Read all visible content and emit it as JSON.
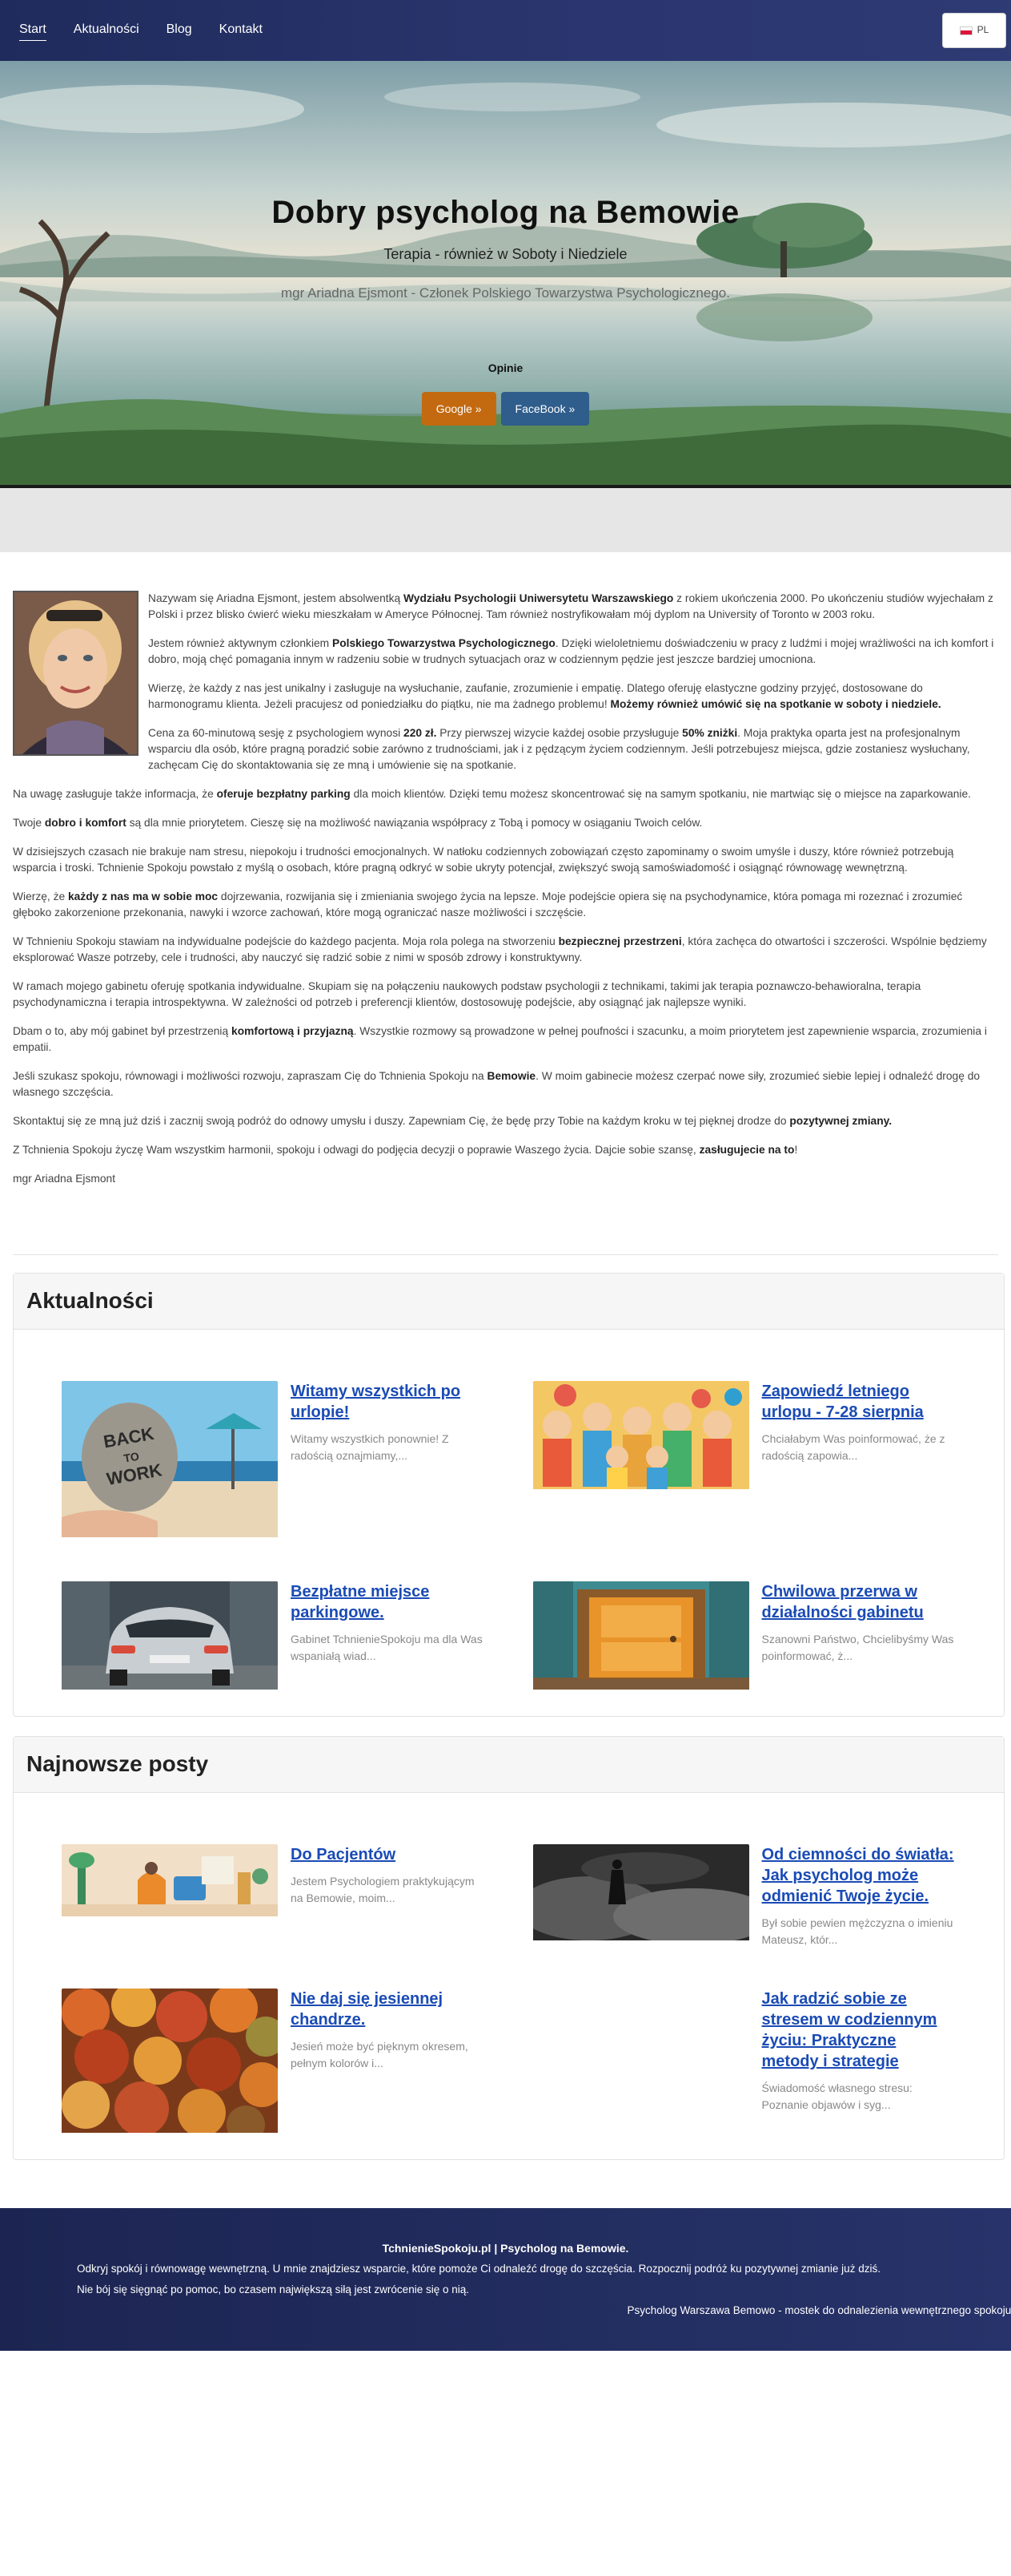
{
  "nav": {
    "items": [
      "Start",
      "Aktualności",
      "Blog",
      "Kontakt"
    ],
    "language": "PL"
  },
  "hero": {
    "title": "Dobry psycholog na Bemowie",
    "subtitle": "Terapia - również w Soboty i Niedziele",
    "credentials": "mgr Ariadna Ejsmont - Członek Polskiego Towarzystwa Psychologicznego.",
    "opinions_label": "Opinie",
    "google_button": "Google »",
    "facebook_button": "FaceBook »"
  },
  "about": {
    "p1": [
      {
        "t": "Nazywam się Ariadna Ejsmont, jestem absolwentką "
      },
      {
        "t": "Wydziału Psychologii Uniwersytetu Warszawskiego",
        "b": true
      },
      {
        "t": " z rokiem ukończenia 2000. Po ukończeniu studiów wyjechałam z Polski i przez blisko ćwierć wieku mieszkałam w Ameryce Północnej. Tam również nostryfikowałam mój dyplom na University of Toronto w 2003 roku."
      }
    ],
    "p2": [
      {
        "t": "Jestem również aktywnym członkiem "
      },
      {
        "t": "Polskiego Towarzystwa Psychologicznego",
        "b": true
      },
      {
        "t": ". Dzięki wieloletniemu doświadczeniu w pracy z ludźmi i mojej wrażliwości na ich komfort i dobro, moją chęć pomagania innym w radzeniu sobie w trudnych sytuacjach oraz w codziennym pędzie jest jeszcze bardziej umocniona."
      }
    ],
    "p3": [
      {
        "t": "Wierzę, że każdy z nas jest unikalny i zasługuje na wysłuchanie, zaufanie, zrozumienie i empatię. Dlatego oferuję elastyczne godziny przyjęć, dostosowane do harmonogramu klienta. Jeżeli pracujesz od poniedziałku do piątku, nie ma żadnego problemu! "
      },
      {
        "t": "Możemy również umówić się na spotkanie w soboty i niedziele.",
        "b": true
      }
    ],
    "p4": [
      {
        "t": "Cena za 60-minutową sesję z psychologiem wynosi "
      },
      {
        "t": "220 zł.",
        "b": true
      },
      {
        "t": " Przy pierwszej wizycie każdej osobie przysługuje "
      },
      {
        "t": "50% zniżki",
        "b": true
      },
      {
        "t": ". Moja praktyka oparta jest na profesjonalnym wsparciu dla osób, które pragną poradzić sobie zarówno z trudnościami, jak i z pędzącym życiem codziennym. Jeśli potrzebujesz miejsca, gdzie zostaniesz wysłuchany, zachęcam Cię do skontaktowania się ze mną i umówienie się na spotkanie."
      }
    ],
    "p5": [
      {
        "t": " Na uwagę zasługuje także informacja, że "
      },
      {
        "t": "oferuje bezpłatny parking",
        "b": true
      },
      {
        "t": " dla moich klientów. Dzięki temu możesz skoncentrować się na samym spotkaniu, nie martwiąc się o miejsce na zaparkowanie."
      }
    ],
    "p6": [
      {
        "t": "Twoje "
      },
      {
        "t": "dobro i komfort",
        "b": true
      },
      {
        "t": " są dla mnie priorytetem. Cieszę się na możliwość nawiązania współpracy z Tobą i pomocy w osiąganiu Twoich celów."
      }
    ],
    "p7": [
      {
        "t": "W dzisiejszych czasach nie brakuje nam stresu, niepokoju i trudności emocjonalnych. W natłoku codziennych zobowiązań często zapominamy o swoim umyśle i duszy, które również potrzebują wsparcia i troski. Tchnienie Spokoju powstało z myślą o osobach, które pragną odkryć w sobie ukryty potencjał, zwiększyć swoją samoświadomość i osiągnąć równowagę wewnętrzną."
      }
    ],
    "p8": [
      {
        "t": "Wierzę, że "
      },
      {
        "t": "każdy z nas ma w sobie moc",
        "b": true
      },
      {
        "t": " dojrzewania, rozwijania się i zmieniania swojego życia na lepsze. Moje podejście opiera się na psychodynamice, która pomaga mi rozeznać i zrozumieć głęboko zakorzenione przekonania, nawyki i wzorce zachowań, które mogą ograniczać nasze możliwości i szczęście."
      }
    ],
    "p9": [
      {
        "t": "W Tchnieniu Spokoju stawiam na indywidualne podejście do każdego pacjenta. Moja rola polega na stworzeniu "
      },
      {
        "t": "bezpiecznej przestrzeni",
        "b": true
      },
      {
        "t": ", która zachęca do otwartości i szczerości. Wspólnie będziemy eksplorować Wasze potrzeby, cele i trudności, aby nauczyć się radzić sobie z nimi w sposób zdrowy i konstruktywny."
      }
    ],
    "p10": [
      {
        "t": "W ramach mojego gabinetu oferuję spotkania indywidualne. Skupiam się na połączeniu naukowych podstaw psychologii z technikami, takimi jak terapia poznawczo-behawioralna, terapia psychodynamiczna i terapia introspektywna. W zależności od potrzeb i preferencji klientów, dostosowuję podejście, aby osiągnąć jak najlepsze wyniki."
      }
    ],
    "p11": [
      {
        "t": "Dbam o to, aby mój gabinet był przestrzenią "
      },
      {
        "t": "komfortową i przyjazną",
        "b": true
      },
      {
        "t": ". Wszystkie rozmowy są prowadzone w pełnej poufności i szacunku, a moim priorytetem jest zapewnienie wsparcia, zrozumienia i empatii."
      }
    ],
    "p12": [
      {
        "t": "Jeśli szukasz spokoju, równowagi i możliwości rozwoju, zapraszam Cię do Tchnienia Spokoju na "
      },
      {
        "t": "Bemowie",
        "b": true
      },
      {
        "t": ". W moim gabinecie możesz czerpać nowe siły, zrozumieć siebie lepiej i odnaleźć drogę do własnego szczęścia."
      }
    ],
    "p13": [
      {
        "t": "Skontaktuj się ze mną już dziś i zacznij swoją podróż do odnowy umysłu i duszy. Zapewniam Cię, że będę przy Tobie na każdym kroku w tej pięknej drodze do "
      },
      {
        "t": "pozytywnej zmiany.",
        "b": true
      }
    ],
    "p14": [
      {
        "t": "Z Tchnienia Spokoju życzę Wam wszystkim harmonii, spokoju i odwagi do podjęcia decyzji o poprawie Waszego życia. Dajcie sobie szansę, "
      },
      {
        "t": "zasługujecie na to",
        "b": true
      },
      {
        "t": "!"
      }
    ],
    "signature": "mgr Ariadna Ejsmont"
  },
  "news": {
    "heading": "Aktualności",
    "items": [
      {
        "title": "Witamy wszystkich po urlopie!",
        "excerpt": "Witamy wszystkich ponownie! Z radością oznajmiamy,...",
        "image": "back-to-work-stone-beach-image"
      },
      {
        "title": "Zapowiedź letniego urlopu - 7-28 sierpnia",
        "excerpt": "Chciałabym Was poinformować, że z radością zapowia...",
        "image": "cartoon-family-group-image"
      },
      {
        "title": "Bezpłatne miejsce parkingowe.",
        "excerpt": "Gabinet TchnienieSpokoju ma dla Was wspaniałą wiad...",
        "image": "parked-car-garage-image"
      },
      {
        "title": "Chwilowa przerwa w działalności gabinetu",
        "excerpt": "Szanowni Państwo, Chcielibyśmy Was poinformować, ż...",
        "image": "closed-door-image"
      }
    ]
  },
  "posts": {
    "heading": "Najnowsze posty",
    "items": [
      {
        "title": "Do Pacjentów",
        "excerpt": "Jestem Psychologiem praktykującym na Bemowie, moim...",
        "image": "therapy-session-illustration-image"
      },
      {
        "title": "Od ciemności do światła: Jak psycholog może odmienić Twoje życie.",
        "excerpt": "Był sobie pewien mężczyzna o imieniu Mateusz, któr...",
        "image": "dark-figure-clouds-image"
      },
      {
        "title": "Nie daj się jesiennej chandrze.",
        "excerpt": "Jesień może być pięknym okresem, pełnym kolorów i...",
        "image": "autumn-trees-image"
      },
      {
        "title": "Jak radzić sobie ze stresem w codziennym życiu: Praktyczne metody i strategie",
        "excerpt": "Świadomość własnego stresu: Poznanie objawów i syg...",
        "image": ""
      }
    ]
  },
  "footer": {
    "title": "TchnienieSpokoju.pl | Psycholog na Bemowie.",
    "line1": "Odkryj spokój i równowagę wewnętrzną. U mnie znajdziesz wsparcie, które pomoże Ci odnaleźć drogę do szczęścia. Rozpocznij podróż ku pozytywnej zmianie już dziś.",
    "line2": "Nie bój się sięgnąć po pomoc, bo czasem największą siłą jest zwrócenie się o nią.",
    "line3": "Psycholog Warszawa Bemowo - mostek do odnalezienia wewnętrznego spokoju."
  }
}
